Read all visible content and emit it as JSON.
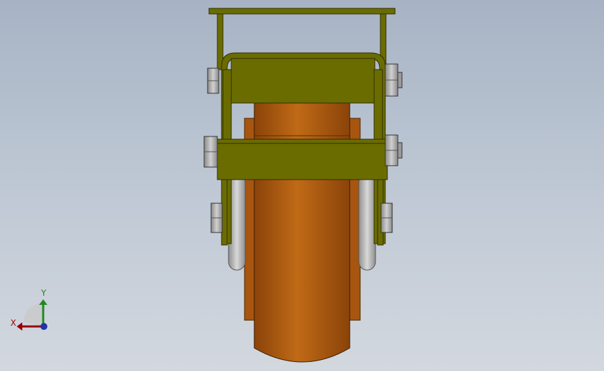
{
  "viewport": {
    "background_top": "#a7b3c4",
    "background_bottom": "#d3d8df"
  },
  "model": {
    "frame_color": "#6b6c00",
    "frame_edge_color": "#3b3a00",
    "wheel_color": "#b85f12",
    "wheel_shadow_color": "#7a3b08",
    "hub_color": "#c8c8c8",
    "nut_color": "#b8b8b8"
  },
  "triad": {
    "x_label": "X",
    "y_label": "Y",
    "x_color": "#9b0000",
    "y_color": "#1f8a1f",
    "z_color": "#2233aa"
  }
}
